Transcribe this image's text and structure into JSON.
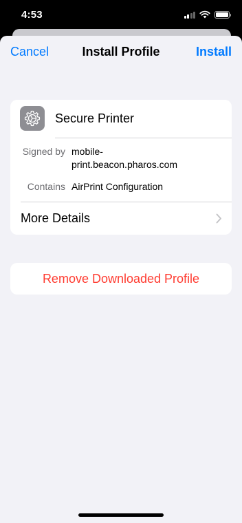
{
  "status_bar": {
    "time": "4:53",
    "icons": [
      "cellular-signal-icon",
      "wifi-icon",
      "battery-icon"
    ]
  },
  "nav": {
    "cancel_label": "Cancel",
    "title": "Install Profile",
    "install_label": "Install"
  },
  "profile": {
    "icon": "gear-icon",
    "name": "Secure Printer",
    "details": [
      {
        "label": "Signed by",
        "value": "mobile-print.beacon.pharos.com",
        "value_lines": [
          "mobile-",
          "print.beacon.pharos.com"
        ]
      },
      {
        "label": "Contains",
        "value": "AirPrint Configuration"
      }
    ],
    "more_details_label": "More Details"
  },
  "actions": {
    "remove_label": "Remove Downloaded Profile"
  },
  "colors": {
    "accent": "#007aff",
    "destructive": "#ff3b30",
    "background": "#f2f2f7",
    "secondary_text": "#6c6c70",
    "icon_background": "#8e8e93"
  }
}
